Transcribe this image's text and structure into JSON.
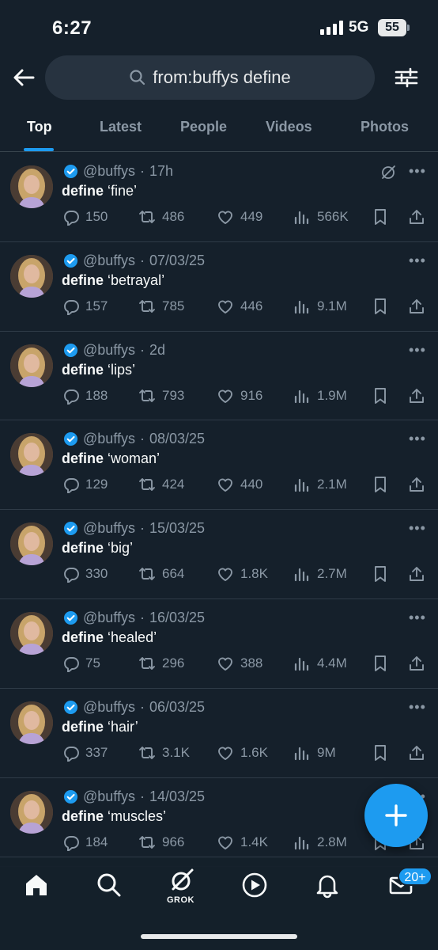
{
  "status": {
    "time": "6:27",
    "network": "5G",
    "battery": "55"
  },
  "search": {
    "query": "from:buffys define"
  },
  "tabs": [
    {
      "label": "Top"
    },
    {
      "label": "Latest"
    },
    {
      "label": "People"
    },
    {
      "label": "Videos"
    },
    {
      "label": "Photos"
    }
  ],
  "tweets": [
    {
      "handle": "@buffys",
      "time": "17h",
      "prefix": "define",
      "word": "‘fine’",
      "replies": "150",
      "reposts": "486",
      "likes": "449",
      "views": "566K"
    },
    {
      "handle": "@buffys",
      "time": "07/03/25",
      "prefix": "define",
      "word": "‘betrayal’",
      "replies": "157",
      "reposts": "785",
      "likes": "446",
      "views": "9.1M"
    },
    {
      "handle": "@buffys",
      "time": "2d",
      "prefix": "define",
      "word": "‘lips’",
      "replies": "188",
      "reposts": "793",
      "likes": "916",
      "views": "1.9M"
    },
    {
      "handle": "@buffys",
      "time": "08/03/25",
      "prefix": "define",
      "word": "‘woman’",
      "replies": "129",
      "reposts": "424",
      "likes": "440",
      "views": "2.1M"
    },
    {
      "handle": "@buffys",
      "time": "15/03/25",
      "prefix": "define",
      "word": "‘big’",
      "replies": "330",
      "reposts": "664",
      "likes": "1.8K",
      "views": "2.7M"
    },
    {
      "handle": "@buffys",
      "time": "16/03/25",
      "prefix": "define",
      "word": "‘healed’",
      "replies": "75",
      "reposts": "296",
      "likes": "388",
      "views": "4.4M"
    },
    {
      "handle": "@buffys",
      "time": "06/03/25",
      "prefix": "define",
      "word": "‘hair’",
      "replies": "337",
      "reposts": "3.1K",
      "likes": "1.6K",
      "views": "9M"
    },
    {
      "handle": "@buffys",
      "time": "14/03/25",
      "prefix": "define",
      "word": "‘muscles’",
      "replies": "184",
      "reposts": "966",
      "likes": "1.4K",
      "views": "2.8M"
    }
  ],
  "separator": "·",
  "bottom_nav": {
    "grok_label": "GROK",
    "messages_badge": "20+"
  },
  "colors": {
    "background": "#15202b",
    "accent": "#1d9bf0",
    "muted": "#8b98a5",
    "search_bg": "#273340"
  }
}
